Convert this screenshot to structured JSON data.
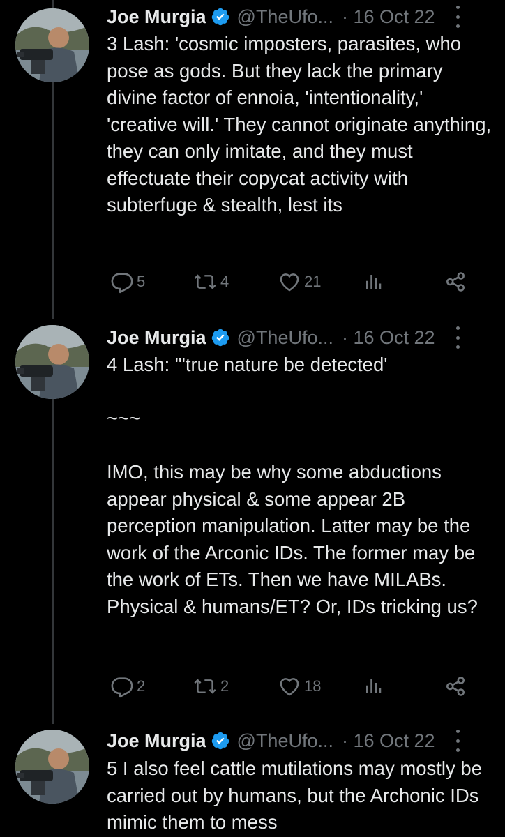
{
  "colors": {
    "background": "#000000",
    "text": "#e7e9ea",
    "secondary": "#71767b",
    "verified": "#1d9bf0",
    "thread_line": "#333639"
  },
  "tweets": [
    {
      "author": "Joe Murgia",
      "handle": "@TheUfo...",
      "date": "· 16 Oct 22",
      "text": "3 Lash: 'cosmic imposters, parasites, who pose as gods. But they lack the primary divine factor of ennoia, 'intentionality,' 'creative will.' They cannot originate anything, they can only imitate, and they must effectuate their copycat activity with subterfuge & stealth, lest its",
      "replies": "5",
      "retweets": "4",
      "likes": "21"
    },
    {
      "author": "Joe Murgia",
      "handle": "@TheUfo...",
      "date": "· 16 Oct 22",
      "text": "4 Lash: \"'true nature be detected'\n\n~~~\n\nIMO, this may be why some abductions appear physical & some appear 2B perception manipulation. Latter may be the work of the Arconic IDs. The former may be the work of ETs. Then we have MILABs. Physical & humans/ET? Or, IDs tricking us?",
      "replies": "2",
      "retweets": "2",
      "likes": "18"
    },
    {
      "author": "Joe Murgia",
      "handle": "@TheUfo...",
      "date": "· 16 Oct 22",
      "text": "5 I also feel cattle mutilations may mostly be carried out by humans, but the Archonic IDs mimic them to mess"
    }
  ]
}
